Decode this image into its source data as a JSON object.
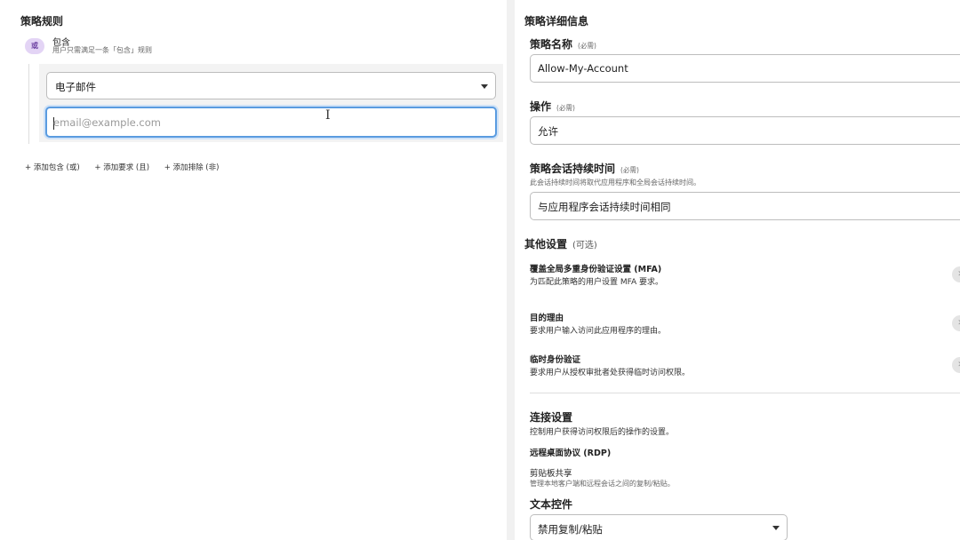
{
  "left": {
    "title": "策略规则",
    "rule": {
      "badge": "或",
      "title": "包含",
      "desc": "用户只需满足一条「包含」规则",
      "selector_value": "电子邮件",
      "email_placeholder": "email@example.com"
    },
    "add_links": [
      "+ 添加包含 (或)",
      "+ 添加要求 (且)",
      "+ 添加排除 (非)"
    ]
  },
  "right": {
    "title": "策略详细信息",
    "required_tag": "(必需)",
    "policy_name": {
      "label": "策略名称",
      "value": "Allow-My-Account"
    },
    "action": {
      "label": "操作",
      "value": "允许"
    },
    "session": {
      "label": "策略会话持续时间",
      "desc": "此会话持续时间将取代应用程序和全局会话持续时间。",
      "value": "与应用程序会话持续时间相同"
    },
    "other": {
      "title": "其他设置",
      "optional": "(可选)",
      "items": [
        {
          "title": "覆盖全局多重身份验证设置 (MFA)",
          "desc": "为匹配此策略的用户设置 MFA 要求。"
        },
        {
          "title": "目的理由",
          "desc": "要求用户输入访问此应用程序的理由。"
        },
        {
          "title": "临时身份验证",
          "desc": "要求用户从授权审批者处获得临时访问权限。"
        }
      ]
    },
    "connection": {
      "title": "连接设置",
      "desc": "控制用户获得访问权限后的操作的设置。",
      "rdp": "远程桌面协议 (RDP)",
      "clipboard_title": "剪贴板共享",
      "clipboard_desc": "管理本地客户端和远程会话之间的复制/粘贴。",
      "text_controls_label": "文本控件",
      "text_controls_value": "禁用复制/粘贴"
    }
  }
}
